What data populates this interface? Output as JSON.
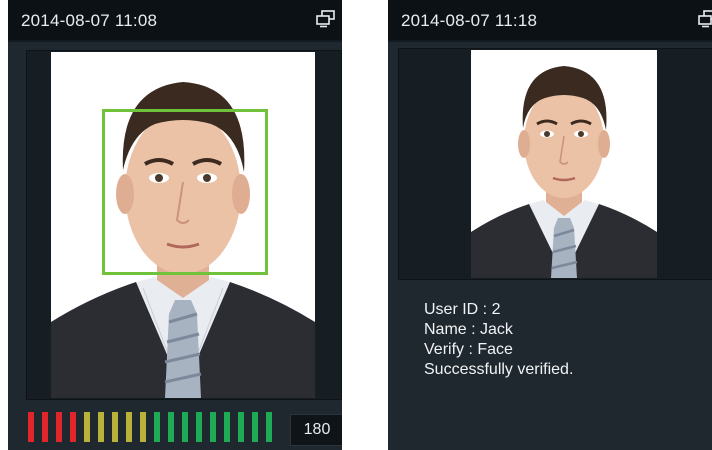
{
  "left_screen": {
    "datetime": "2014-08-07 11:08",
    "status_icon": "network-icon",
    "face_frame_color": "#6fc23a",
    "match_score": "180",
    "meter": {
      "segments": 18,
      "lit_level": 1.0,
      "colors": {
        "red": "#e0262a",
        "yellow": "#b8b23a",
        "green": "#1faa55"
      }
    }
  },
  "right_screen": {
    "datetime": "2014-08-07 11:18",
    "status_icon": "network-icon",
    "result": {
      "user_id": "User ID : 2",
      "name": "Name : Jack",
      "verify": "Verify : Face",
      "message": "Successfully verified."
    }
  },
  "colors": {
    "screen_bg": "#1e282e",
    "statusbar_bg": "#0c1115",
    "text": "#e9edf0"
  }
}
